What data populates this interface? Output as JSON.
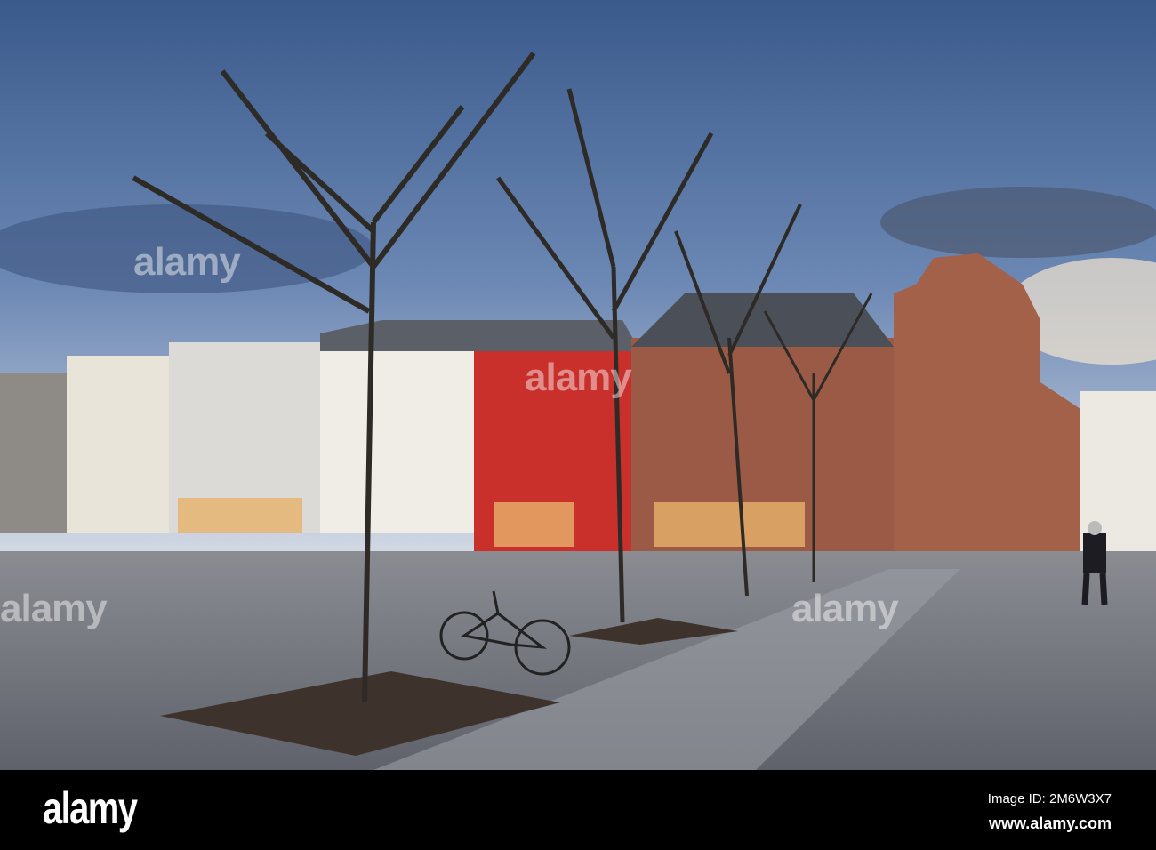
{
  "photo": {
    "subject": "Town market square with bare trees, bicycle and historic gabled brick building",
    "colors": {
      "sky_top": "#3a5a8c",
      "sky_bottom": "#c9d6e6",
      "cobble": "#7d7f86",
      "red_house": "#c9302c",
      "brick": "#9a5a45"
    }
  },
  "watermark": {
    "text": "alamy"
  },
  "footer": {
    "logo": "alamy",
    "image_id": "Image ID: 2M6W3X7",
    "url": "www.alamy.com"
  }
}
